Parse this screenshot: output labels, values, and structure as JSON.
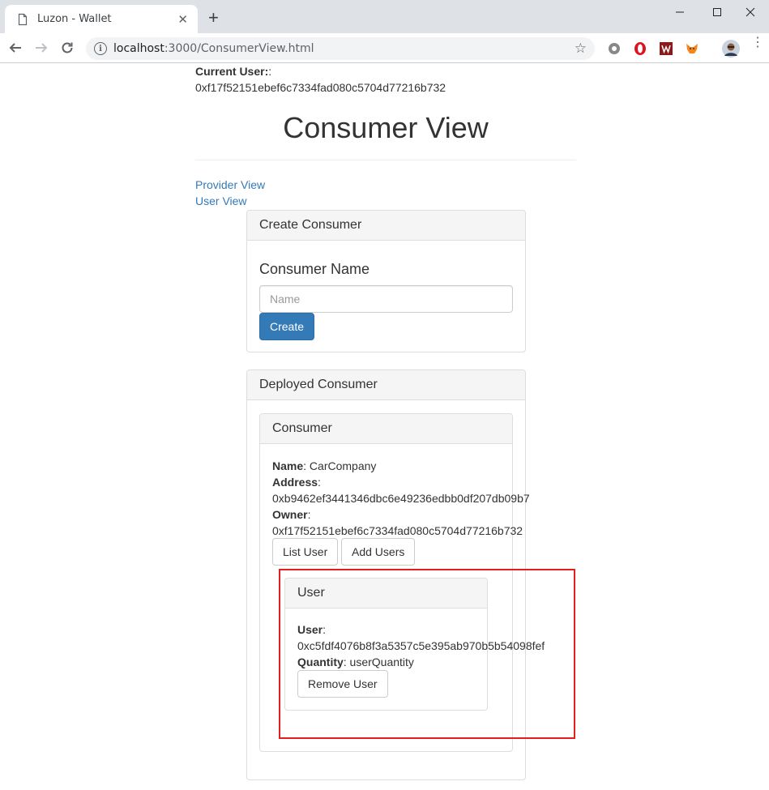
{
  "browser": {
    "tab_title": "Luzon - Wallet",
    "url_host": "localhost",
    "url_path": ":3000/ConsumerView.html"
  },
  "header": {
    "current_user_label": "Current User:",
    "current_user_sep": ":",
    "current_user_address": "0xf17f52151ebef6c7334fad080c5704d77216b732",
    "title": "Consumer View"
  },
  "nav": {
    "provider_view": "Provider View",
    "user_view": "User View"
  },
  "create_consumer": {
    "heading": "Create Consumer",
    "name_label": "Consumer Name",
    "name_placeholder": "Name",
    "create_button": "Create"
  },
  "deployed_consumer": {
    "heading": "Deployed Consumer",
    "consumer": {
      "heading": "Consumer",
      "name_label": "Name",
      "name_value": ": CarCompany",
      "address_label": "Address",
      "address_value": "0xb9462ef3441346dbc6e49236edbb0df207db09b7",
      "owner_label": "Owner",
      "owner_value": "0xf17f52151ebef6c7334fad080c5704d77216b732",
      "list_user_button": "List User",
      "add_users_button": "Add Users",
      "user": {
        "heading": "User",
        "user_label": "User",
        "user_value": "0xc5fdf4076b8f3a5357c5e395ab970b5b54098fef",
        "quantity_label": "Quantity",
        "quantity_value": ": userQuantity",
        "remove_button": "Remove User"
      }
    }
  },
  "colors": {
    "link": "#337ab7",
    "primary_button": "#337ab7",
    "highlight_box": "#e41e1e"
  }
}
